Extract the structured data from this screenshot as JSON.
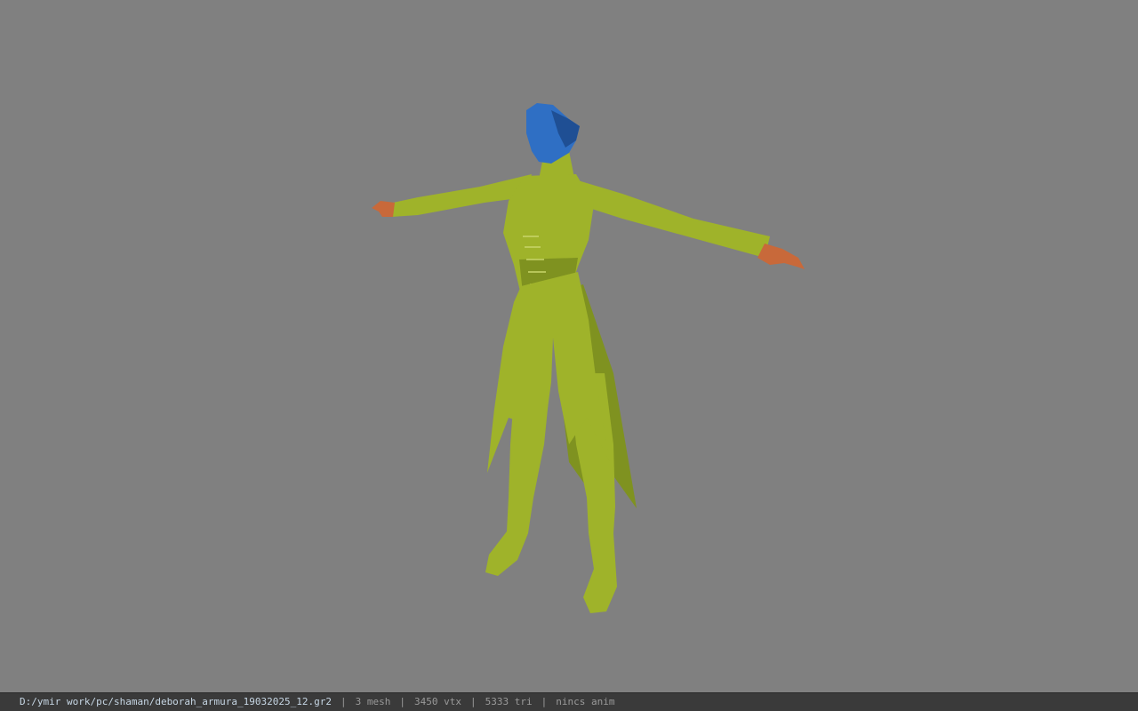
{
  "viewport": {
    "background_color": "#808080",
    "model": {
      "name": "character-model",
      "colors": {
        "body": "#9fb32a",
        "body_shade": "#7f9220",
        "head": "#2f6fc4",
        "head_shade": "#1f4f94",
        "hands": "#c8693a"
      }
    }
  },
  "status_bar": {
    "file_path": "D:/ymir work/pc/shaman/deborah_armura_19032025_12.gr2",
    "separator": "|",
    "mesh_count": "3 mesh",
    "vertex_count": "3450 vtx",
    "triangle_count": "5333 tri",
    "anim_status": "nincs anim"
  }
}
